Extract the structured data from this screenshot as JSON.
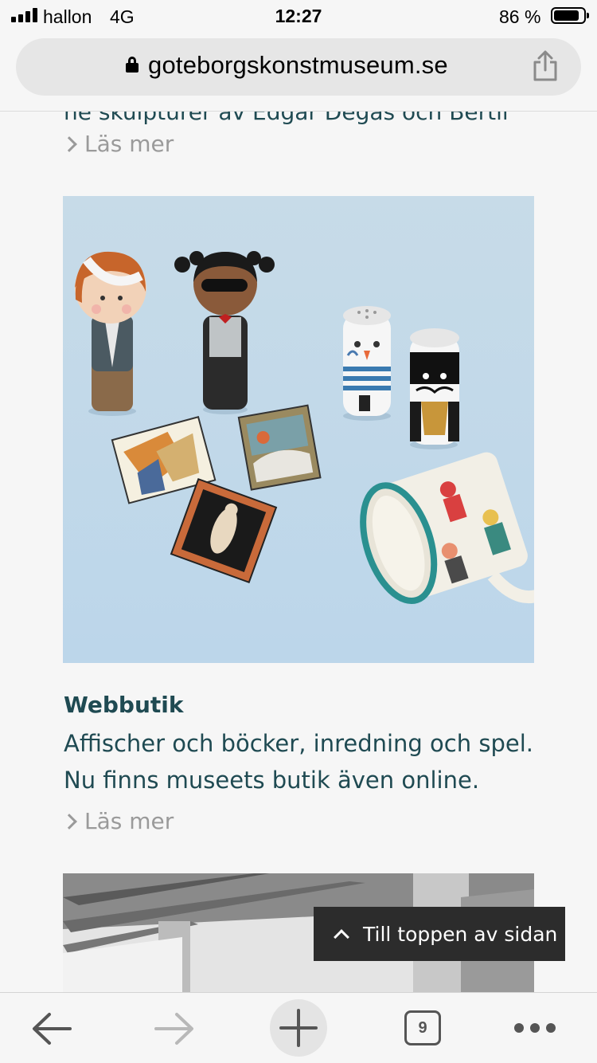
{
  "status_bar": {
    "carrier": "hallon",
    "network": "4G",
    "time": "12:27",
    "battery_percent": "86 %",
    "battery_level": 0.86
  },
  "url_bar": {
    "url": "goteborgskonstmuseum.se"
  },
  "content": {
    "cut_off_text": "ne skulpturer av Edgar Degas och Bertil",
    "read_more_1": "Läs mer",
    "card": {
      "title": "Webbutik",
      "description_line1": "Affischer och böcker, inredning och spel.",
      "description_line2": "Nu finns museets butik även online.",
      "read_more": "Läs mer"
    }
  },
  "back_to_top": {
    "label": "Till toppen av sidan"
  },
  "toolbar": {
    "tab_count": "9",
    "icons": [
      "back-arrow-icon",
      "forward-arrow-icon",
      "new-tab-plus-icon",
      "tabs-icon",
      "more-dots-icon"
    ]
  },
  "colors": {
    "text_primary": "#1f4a52",
    "text_muted": "#9a9a9a",
    "background": "#f6f6f6",
    "image_background": "#c7dbe8",
    "button_dark": "#2c2c2c"
  }
}
